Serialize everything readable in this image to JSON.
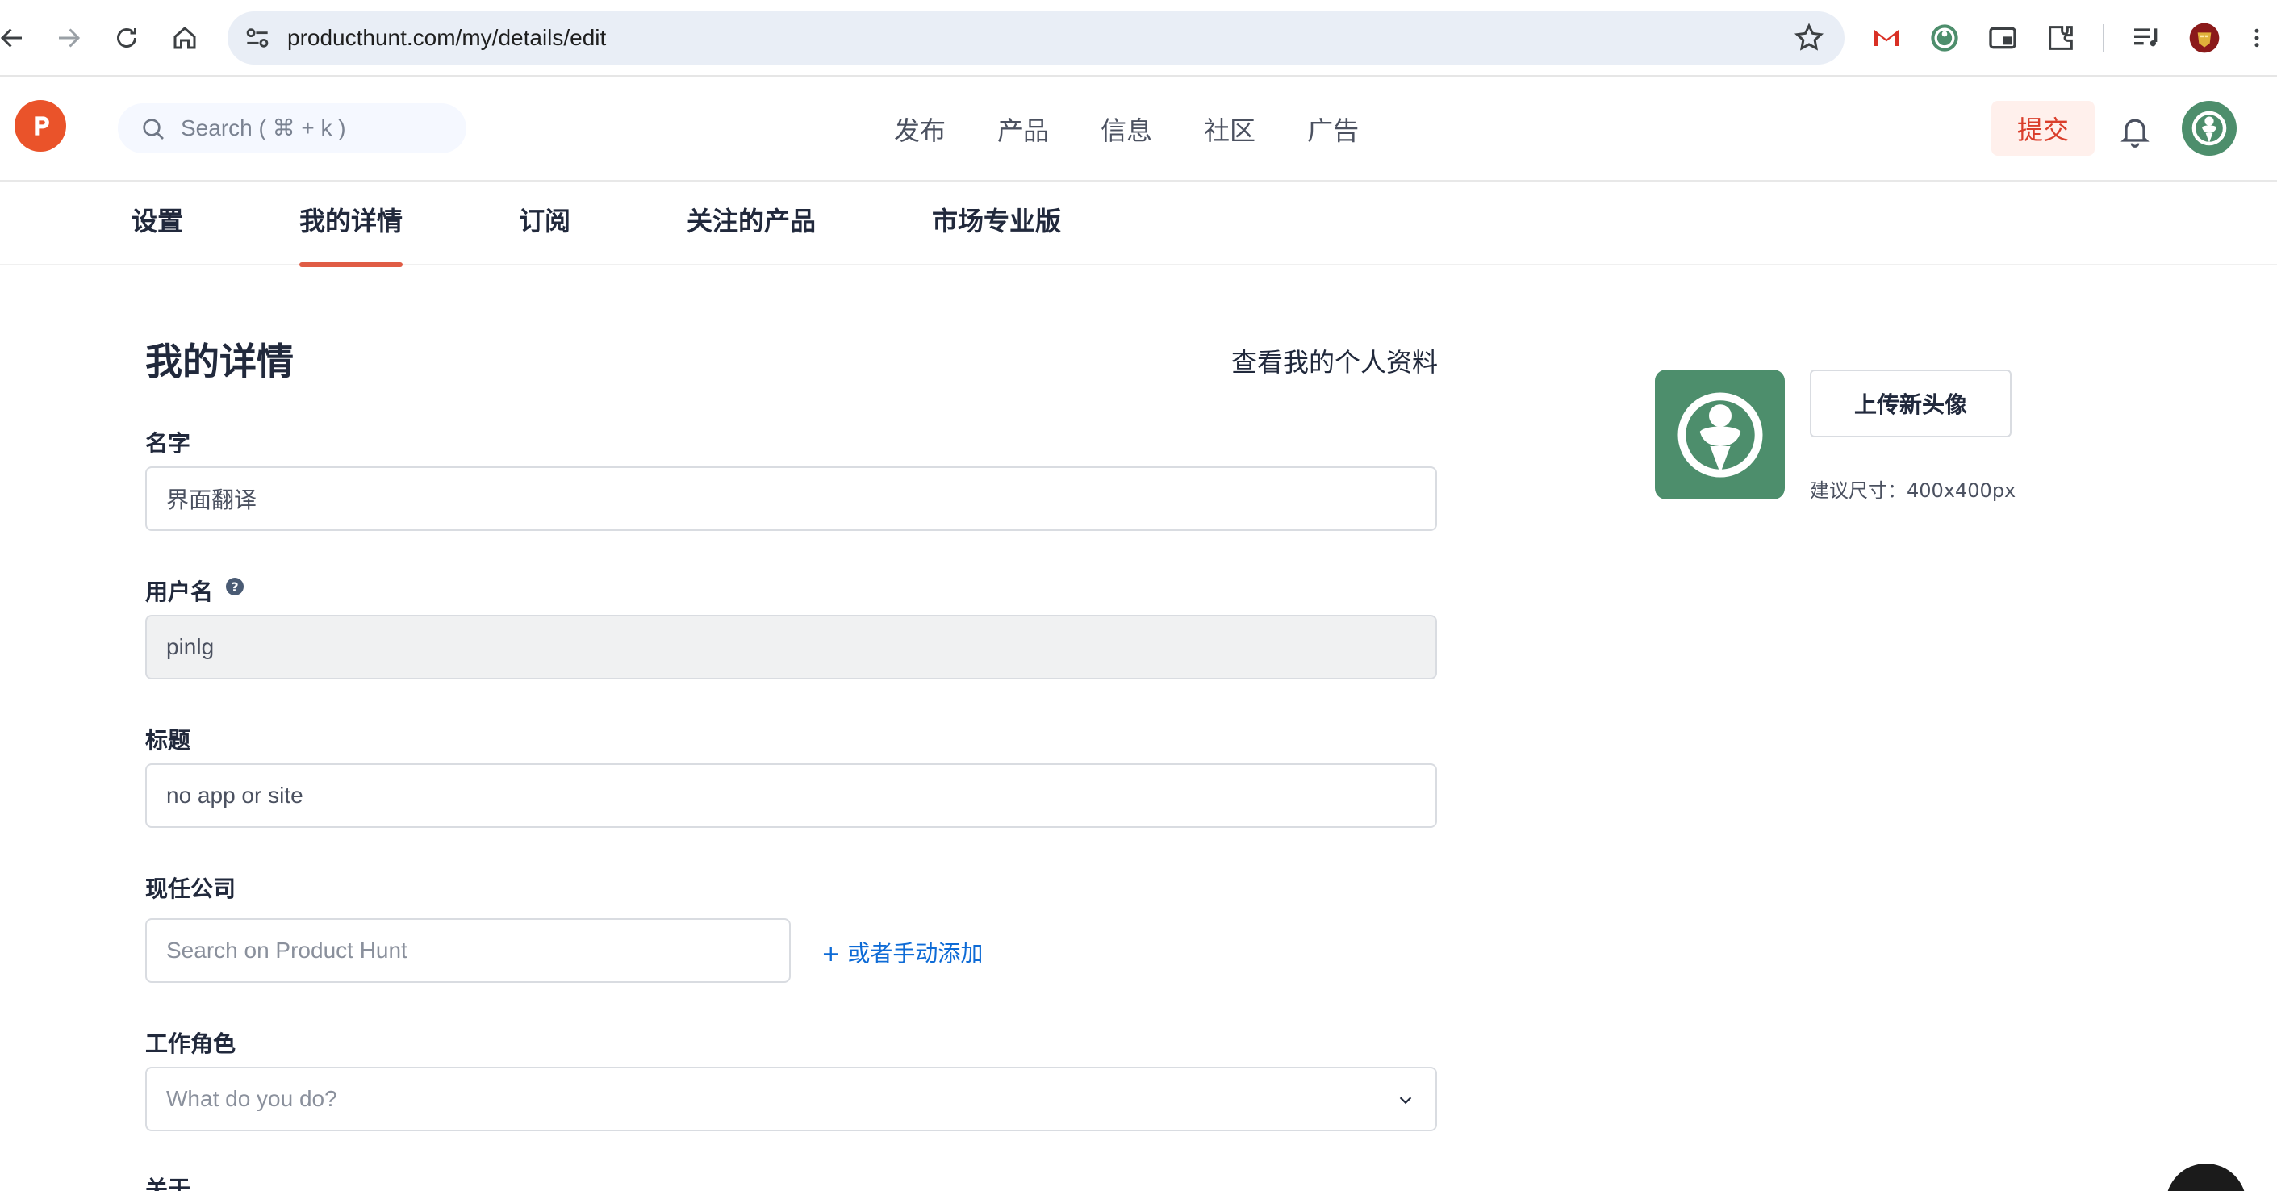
{
  "browser": {
    "url": "producthunt.com/my/details/edit"
  },
  "header": {
    "search_placeholder": "Search ( ⌘ + k )",
    "nav": [
      "发布",
      "产品",
      "信息",
      "社区",
      "广告"
    ],
    "submit_label": "提交"
  },
  "tabs": [
    {
      "label": "设置"
    },
    {
      "label": "我的详情",
      "active": true
    },
    {
      "label": "订阅"
    },
    {
      "label": "关注的产品"
    },
    {
      "label": "市场专业版"
    }
  ],
  "form": {
    "title": "我的详情",
    "view_profile": "查看我的个人资料",
    "name_label": "名字",
    "name_value": "界面翻译",
    "username_label": "用户名",
    "username_value": "pinlg",
    "headline_label": "标题",
    "headline_value": "no app or site",
    "company_label": "现任公司",
    "company_placeholder": "Search on Product Hunt",
    "add_manual": "+ 或者手动添加",
    "role_label": "工作角色",
    "role_placeholder": "What do you do?",
    "about_label": "关于"
  },
  "avatar": {
    "upload_label": "上传新头像",
    "hint": "建议尺寸：400x400px"
  },
  "colors": {
    "brand": "#ea532a",
    "accent": "#e05c45",
    "avatar_green": "#4d8e6c",
    "link": "#0e6bd6"
  }
}
